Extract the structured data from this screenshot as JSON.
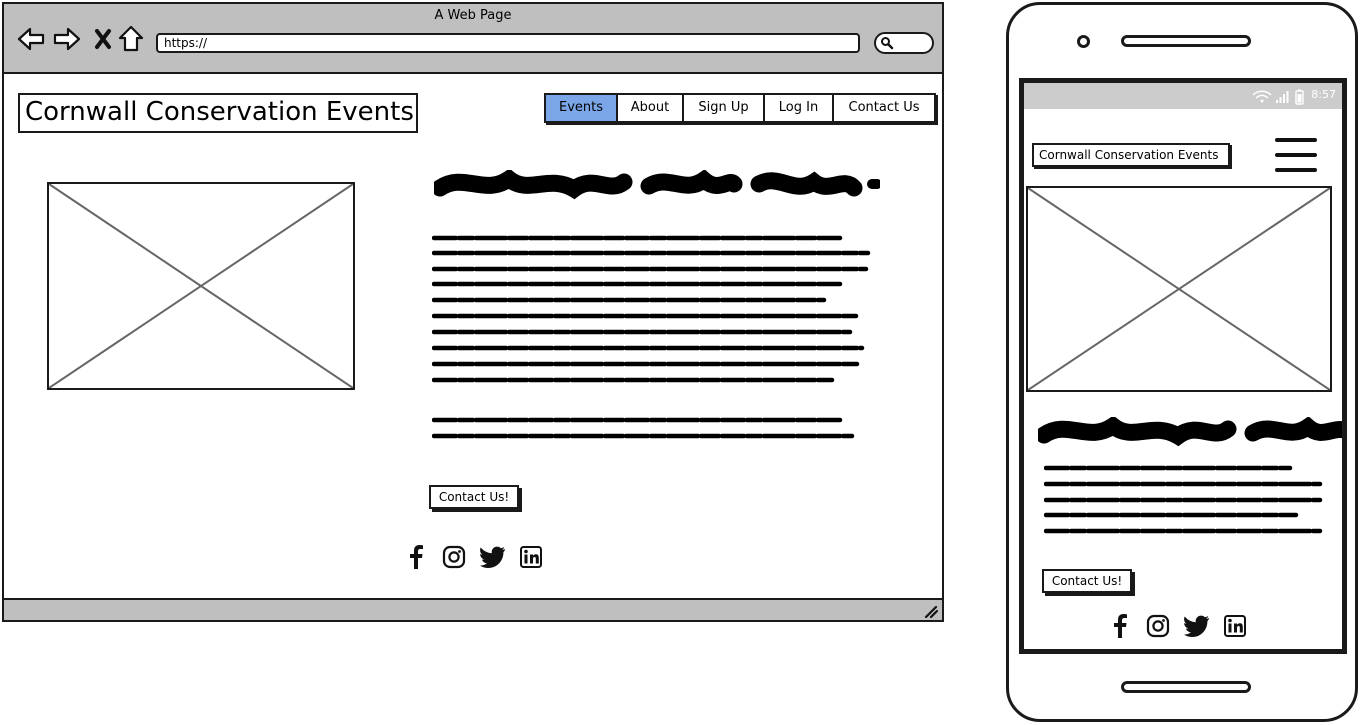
{
  "browser": {
    "title": "A Web Page",
    "url": "https://",
    "icons": {
      "back": "arrow-left-icon",
      "forward": "arrow-right-icon",
      "stop": "close-icon",
      "home": "home-icon",
      "search": "search-icon"
    }
  },
  "site": {
    "title": "Cornwall Conservation Events"
  },
  "nav": {
    "items": [
      {
        "label": "Events",
        "active": true
      },
      {
        "label": "About"
      },
      {
        "label": "Sign Up"
      },
      {
        "label": "Log In"
      },
      {
        "label": "Contact Us"
      }
    ],
    "active_color": "#7ba7e8"
  },
  "main": {
    "cta_label": "Contact Us!"
  },
  "social": [
    "facebook-icon",
    "instagram-icon",
    "twitter-icon",
    "linkedin-icon"
  ],
  "mobile": {
    "clock": "8:57",
    "title": "Cornwall Conservation Events",
    "cta_label": "Contact Us!",
    "menu_icon": "hamburger-menu-icon"
  }
}
